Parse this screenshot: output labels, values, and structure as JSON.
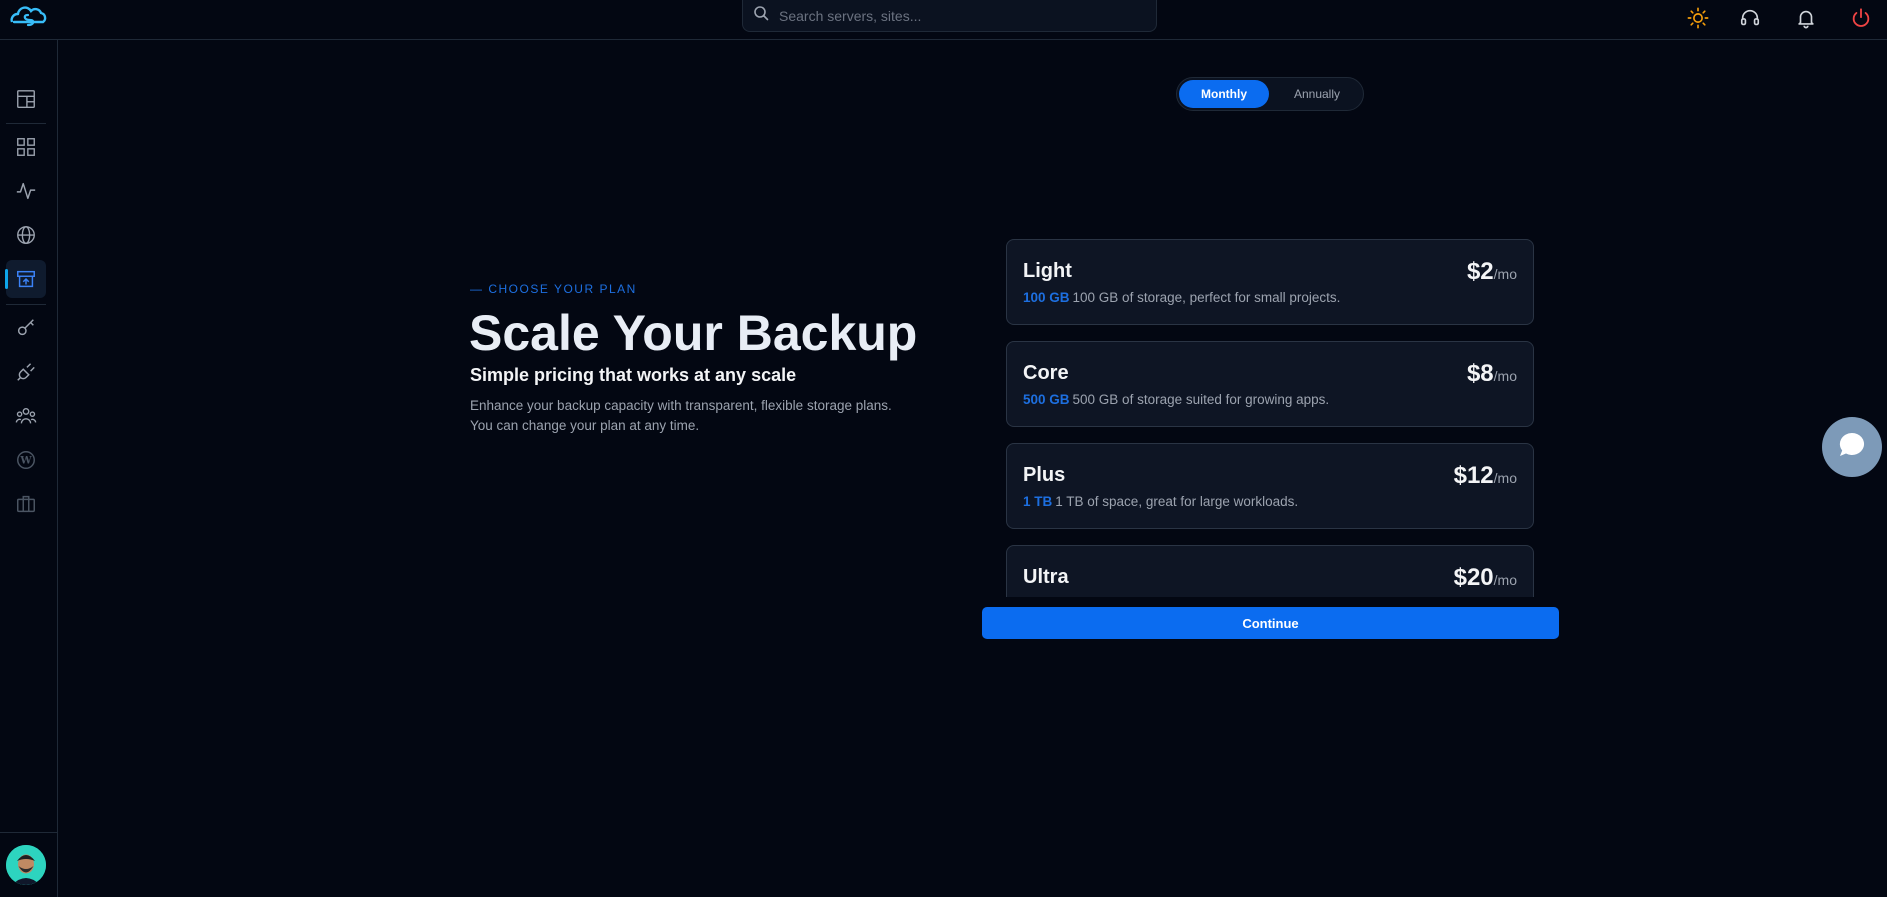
{
  "header": {
    "logo": "cloudstick-logo",
    "search_placeholder": "Search servers, sites...",
    "icons": [
      "sun-icon",
      "headset-icon",
      "bell-icon",
      "power-icon"
    ]
  },
  "sidebar": {
    "items": [
      {
        "name": "dashboard-icon",
        "active": false
      },
      {
        "name": "apps-grid-icon",
        "active": false
      },
      {
        "name": "activity-icon",
        "active": false
      },
      {
        "name": "globe-icon",
        "active": false
      },
      {
        "name": "backup-icon",
        "active": true
      },
      {
        "name": "key-icon",
        "active": false
      },
      {
        "name": "plug-icon",
        "active": false
      },
      {
        "name": "team-icon",
        "active": false
      },
      {
        "name": "wordpress-icon",
        "active": false
      },
      {
        "name": "briefcase-icon",
        "active": false
      }
    ]
  },
  "billing": {
    "monthly": "Monthly",
    "annually": "Annually",
    "selected": "Monthly"
  },
  "hero": {
    "eyebrow": "— CHOOSE YOUR PLAN",
    "title": "Scale Your Backup",
    "subtitle": "Simple pricing that works at any scale",
    "desc_line1": "Enhance your backup capacity with transparent, flexible storage plans.",
    "desc_line2": "You can change your plan at any time."
  },
  "plans": [
    {
      "name": "Light",
      "price": "$2",
      "per": "/mo",
      "capacity": "100 GB",
      "desc": "100 GB of storage, perfect for small projects."
    },
    {
      "name": "Core",
      "price": "$8",
      "per": "/mo",
      "capacity": "500 GB",
      "desc": "500 GB of storage suited for growing apps."
    },
    {
      "name": "Plus",
      "price": "$12",
      "per": "/mo",
      "capacity": "1 TB",
      "desc": "1 TB of space, great for large workloads."
    },
    {
      "name": "Ultra",
      "price": "$20",
      "per": "/mo",
      "capacity": "",
      "desc": ""
    }
  ],
  "continue_label": "Continue",
  "colors": {
    "accent": "#0b6cf0",
    "background": "#030712",
    "card": "#0e1524",
    "sun": "#f59e0b",
    "power": "#ef4444"
  }
}
